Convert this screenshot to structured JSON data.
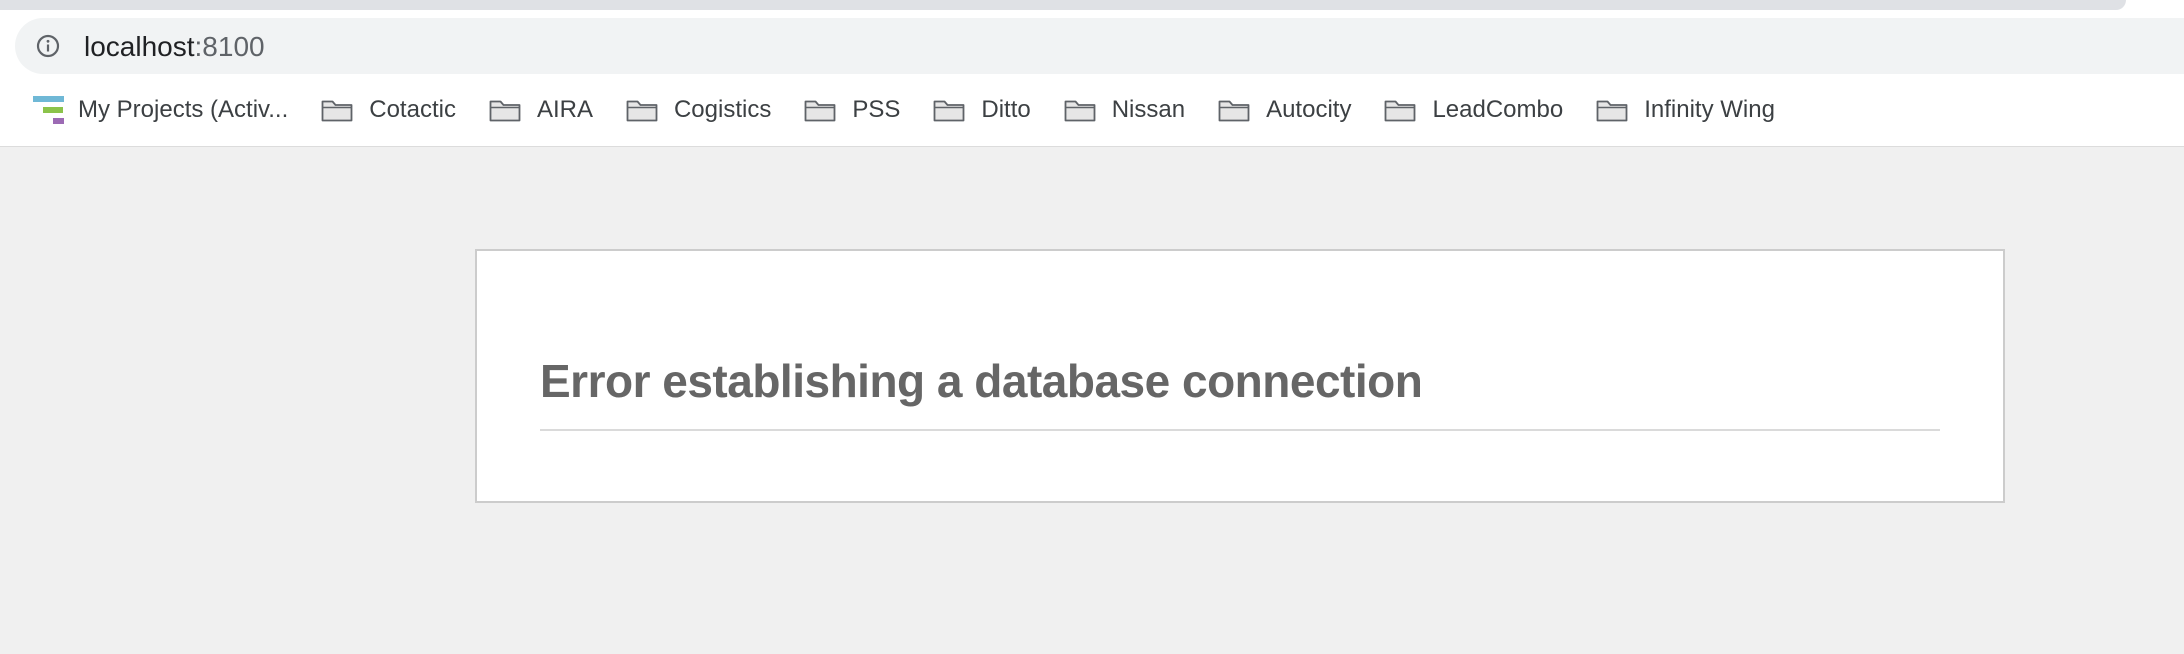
{
  "browser": {
    "address_bar": {
      "host": "localhost",
      "port": ":8100"
    },
    "bookmarks": [
      {
        "label": "My Projects (Activ...",
        "icon": "project-favicon"
      },
      {
        "label": "Cotactic",
        "icon": "folder-icon"
      },
      {
        "label": "AIRA",
        "icon": "folder-icon"
      },
      {
        "label": "Cogistics",
        "icon": "folder-icon"
      },
      {
        "label": "PSS",
        "icon": "folder-icon"
      },
      {
        "label": "Ditto",
        "icon": "folder-icon"
      },
      {
        "label": "Nissan",
        "icon": "folder-icon"
      },
      {
        "label": "Autocity",
        "icon": "folder-icon"
      },
      {
        "label": "LeadCombo",
        "icon": "folder-icon"
      },
      {
        "label": "Infinity Wing",
        "icon": "folder-icon"
      }
    ]
  },
  "page": {
    "error_title": "Error establishing a database connection"
  },
  "colors": {
    "page_background": "#f0f0f0",
    "title_text": "#666666",
    "favicon_bar_1": "#6fb8d6",
    "favicon_bar_2": "#8bc34a",
    "favicon_bar_3": "#9c6ab4"
  }
}
